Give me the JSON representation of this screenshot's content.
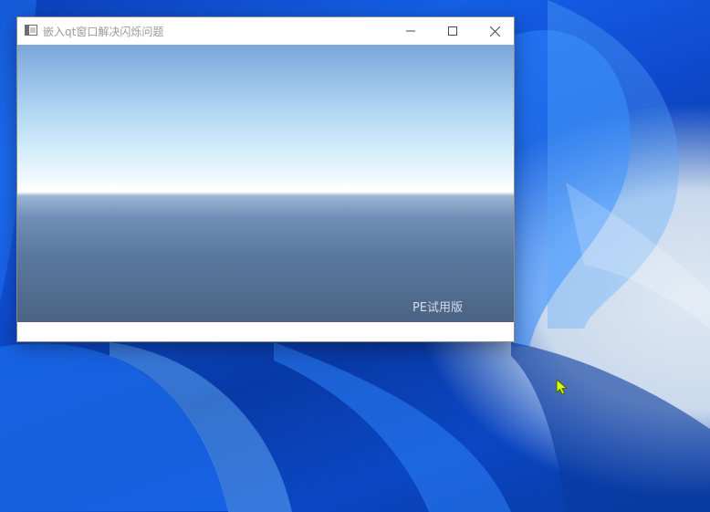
{
  "window": {
    "title": "嵌入qt窗口解决闪烁问题",
    "controls": {
      "minimize_icon": "minimize-icon",
      "maximize_icon": "maximize-icon",
      "close_icon": "close-icon"
    }
  },
  "viewport": {
    "watermark": "PE试用版"
  },
  "desktop": {
    "wallpaper_color": "#0f4bd0",
    "cursor_color": "#d8ff00"
  }
}
